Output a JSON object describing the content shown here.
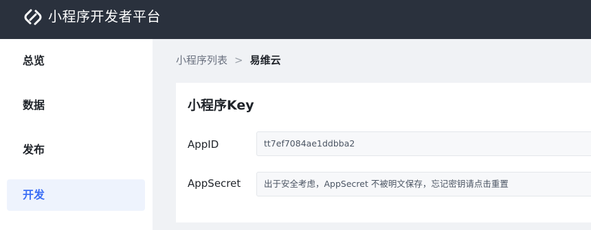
{
  "header": {
    "app_title": "小程序开发者平台",
    "logo_icon": "link-logo-icon"
  },
  "sidebar": {
    "items": [
      {
        "label": "总览",
        "active": false
      },
      {
        "label": "数据",
        "active": false
      },
      {
        "label": "发布",
        "active": false
      },
      {
        "label": "开发",
        "active": true
      }
    ]
  },
  "breadcrumb": {
    "parent": "小程序列表",
    "separator": ">",
    "current": "易维云"
  },
  "card": {
    "title": "小程序Key",
    "fields": [
      {
        "label": "AppID",
        "value": "tt7ef7084ae1ddbba2"
      },
      {
        "label": "AppSecret",
        "value": "出于安全考虑，AppSecret 不被明文保存，忘记密钥请点击重置"
      }
    ]
  },
  "colors": {
    "header_bg": "#2a313d",
    "accent": "#3c6ff5",
    "active_bg": "#eef3fd"
  }
}
